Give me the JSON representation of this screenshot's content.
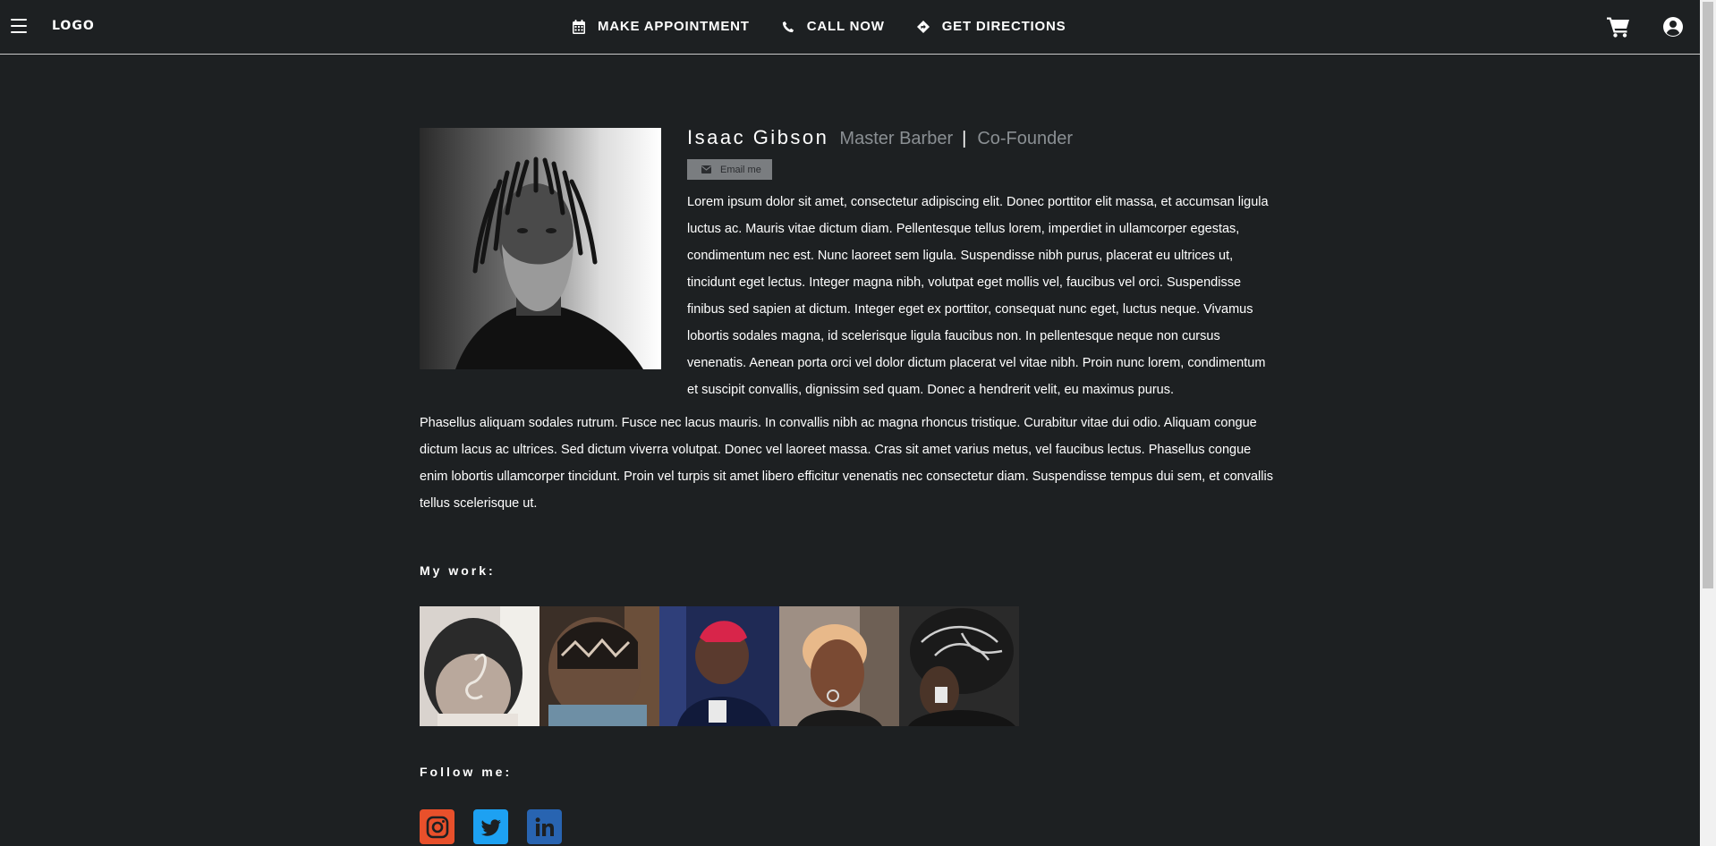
{
  "header": {
    "logo": "LOGO",
    "nav": [
      {
        "label": "MAKE APPOINTMENT",
        "icon": "calendar-icon"
      },
      {
        "label": "CALL NOW",
        "icon": "phone-icon"
      },
      {
        "label": "GET DIRECTIONS",
        "icon": "directions-icon"
      }
    ],
    "right_icons": [
      "cart-icon",
      "user-circle-icon"
    ]
  },
  "profile": {
    "name": "Isaac Gibson",
    "role": "Master Barber",
    "separator": "|",
    "role2": "Co-Founder",
    "email_button": "Email me",
    "bio_paragraph_1": "Lorem ipsum dolor sit amet, consectetur adipiscing elit. Donec porttitor elit massa, et accumsan ligula luctus ac. Mauris vitae dictum diam. Pellentesque tellus lorem, imperdiet in ullamcorper egestas, condimentum nec est. Nunc laoreet sem ligula. Suspendisse nibh purus, placerat eu ultrices ut, tincidunt eget lectus. Integer magna nibh, volutpat eget mollis vel, faucibus vel orci. Suspendisse finibus sed sapien at dictum. Integer eget ex porttitor, consequat nunc eget, luctus neque. Vivamus lobortis sodales magna, id scelerisque ligula faucibus non. In pellentesque neque non cursus venenatis. Aenean porta orci vel dolor dictum placerat vel vitae nibh. Proin nunc lorem, condimentum et suscipit convallis, dignissim sed quam. Donec a hendrerit velit, eu maximus purus.",
    "bio_paragraph_2": "Phasellus aliquam sodales rutrum. Fusce nec lacus mauris. In convallis nibh ac magna rhoncus tristique. Curabitur vitae dui odio. Aliquam congue dictum lacus ac ultrices. Sed dictum viverra volutpat. Donec vel laoreet massa. Cras sit amet varius metus, vel faucibus lectus. Phasellus congue enim lobortis ullamcorper tincidunt. Proin vel turpis sit amet libero efficitur venenatis nec consectetur diam. Suspendisse tempus dui sem, et convallis tellus scelerisque ut."
  },
  "work": {
    "heading": "My work:"
  },
  "follow": {
    "heading": "Follow me:",
    "networks": [
      "instagram-icon",
      "twitter-icon",
      "linkedin-icon"
    ]
  },
  "colors": {
    "background": "#1d2022",
    "muted_role": "#8a8f93",
    "email_button_bg": "#7a7d80",
    "instagram": "#e8502b",
    "twitter": "#1da1f2",
    "linkedin": "#2864b1"
  }
}
